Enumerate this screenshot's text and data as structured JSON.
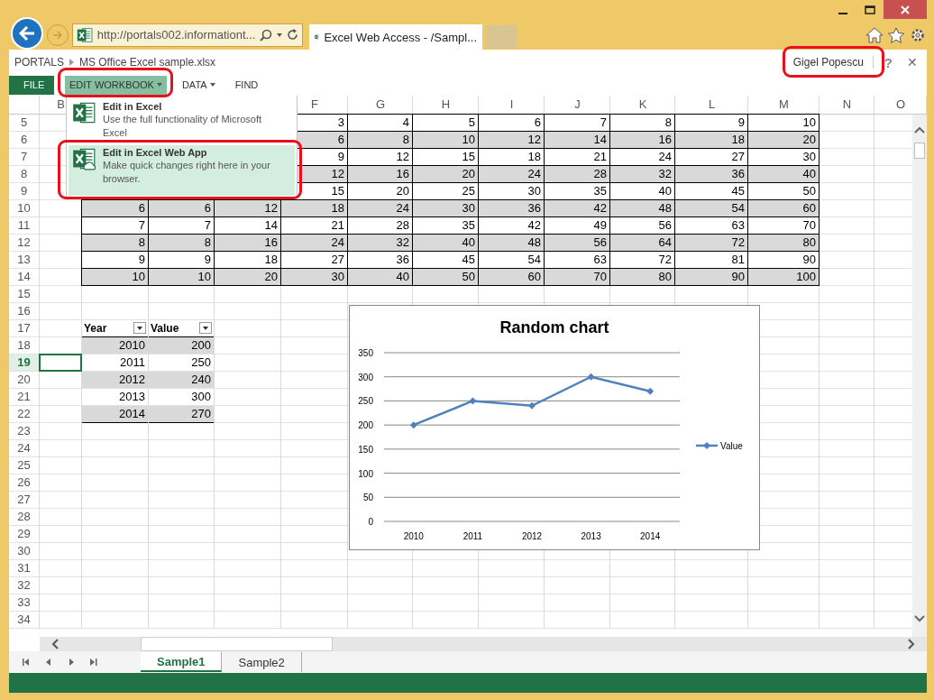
{
  "browser": {
    "address": "http://portals002.informationt...",
    "tab_title": "Excel Web Access - /Sampl..."
  },
  "breadcrumb": [
    "PORTALS",
    "MS Office Excel sample.xlsx"
  ],
  "user": "Gigel Popescu",
  "help": "?",
  "close": "✕",
  "ribbon_tabs": [
    {
      "label": "FILE",
      "kind": "file",
      "selected": false
    },
    {
      "label": "EDIT WORKBOOK",
      "kind": "menu",
      "selected": true
    },
    {
      "label": "DATA",
      "kind": "menu",
      "selected": false
    },
    {
      "label": "FIND",
      "kind": "plain",
      "selected": false
    }
  ],
  "edit_menu": [
    {
      "title": "Edit in Excel",
      "description": "Use the full functionality of Microsoft Excel",
      "kind": "desktop",
      "selected": false
    },
    {
      "title": "Edit in Excel Web App",
      "description": "Make quick changes right here in your browser.",
      "kind": "web",
      "selected": true
    }
  ],
  "columns_left": [
    "B"
  ],
  "columns": [
    "F",
    "G",
    "H",
    "I",
    "J",
    "K",
    "L",
    "M",
    "N",
    "O"
  ],
  "rows": [
    {
      "number": "5",
      "selected": false
    },
    {
      "number": "6",
      "selected": false
    },
    {
      "number": "7",
      "selected": false
    },
    {
      "number": "8",
      "selected": false
    },
    {
      "number": "9",
      "selected": false
    },
    {
      "number": "10",
      "selected": false
    },
    {
      "number": "11",
      "selected": false
    },
    {
      "number": "12",
      "selected": false
    },
    {
      "number": "13",
      "selected": false
    },
    {
      "number": "14",
      "selected": false
    },
    {
      "number": "15",
      "selected": false
    },
    {
      "number": "16",
      "selected": false
    },
    {
      "number": "17",
      "selected": false
    },
    {
      "number": "18",
      "selected": false
    },
    {
      "number": "19",
      "selected": true
    },
    {
      "number": "20",
      "selected": false
    },
    {
      "number": "21",
      "selected": false
    },
    {
      "number": "22",
      "selected": false
    },
    {
      "number": "23",
      "selected": false
    },
    {
      "number": "24",
      "selected": false
    },
    {
      "number": "25",
      "selected": false
    },
    {
      "number": "26",
      "selected": false
    },
    {
      "number": "27",
      "selected": false
    },
    {
      "number": "28",
      "selected": false
    },
    {
      "number": "29",
      "selected": false
    },
    {
      "number": "30",
      "selected": false
    },
    {
      "number": "31",
      "selected": false
    },
    {
      "number": "32",
      "selected": false
    },
    {
      "number": "33",
      "selected": false
    },
    {
      "number": "34",
      "selected": false
    }
  ],
  "data_table": [
    {
      "values": [
        "3",
        "4",
        "5",
        "6",
        "7",
        "8",
        "9",
        "10"
      ]
    },
    {
      "values": [
        "6",
        "8",
        "10",
        "12",
        "14",
        "16",
        "18",
        "20"
      ]
    },
    {
      "values": [
        "9",
        "12",
        "15",
        "18",
        "21",
        "24",
        "27",
        "30"
      ]
    },
    {
      "values": [
        "12",
        "16",
        "20",
        "24",
        "28",
        "32",
        "36",
        "40"
      ]
    },
    {
      "values": [
        "15",
        "20",
        "25",
        "30",
        "35",
        "40",
        "45",
        "50"
      ]
    },
    {
      "values": [
        "6",
        "6",
        "12",
        "18",
        "24",
        "30",
        "36",
        "42",
        "48",
        "54",
        "60"
      ]
    },
    {
      "values": [
        "7",
        "7",
        "14",
        "21",
        "28",
        "35",
        "42",
        "49",
        "56",
        "63",
        "70"
      ]
    },
    {
      "values": [
        "8",
        "8",
        "16",
        "24",
        "32",
        "40",
        "48",
        "56",
        "64",
        "72",
        "80"
      ]
    },
    {
      "values": [
        "9",
        "9",
        "18",
        "27",
        "36",
        "45",
        "54",
        "63",
        "72",
        "81",
        "90"
      ]
    },
    {
      "values": [
        "10",
        "10",
        "20",
        "30",
        "40",
        "50",
        "60",
        "70",
        "80",
        "90",
        "100"
      ]
    }
  ],
  "year_table": {
    "headers": [
      "Year",
      "Value"
    ],
    "rows": [
      [
        "2010",
        "200"
      ],
      [
        "2011",
        "250"
      ],
      [
        "2012",
        "240"
      ],
      [
        "2013",
        "300"
      ],
      [
        "2014",
        "270"
      ]
    ]
  },
  "chart": {
    "chart_data": {
      "type": "line",
      "title": "Random chart",
      "categories": [
        "2010",
        "2011",
        "2012",
        "2013",
        "2014"
      ],
      "ylim": [
        0,
        350
      ],
      "yticks": [
        0,
        50,
        100,
        150,
        200,
        250,
        300,
        350
      ],
      "grid": true,
      "series": [
        {
          "name": "Value",
          "color": "#4f81bd",
          "marker": "diamond",
          "values": [
            200,
            250,
            240,
            300,
            270
          ]
        }
      ]
    }
  },
  "sheet_tabs": [
    {
      "label": "Sample1",
      "selected": true
    },
    {
      "label": "Sample2",
      "selected": false
    }
  ]
}
